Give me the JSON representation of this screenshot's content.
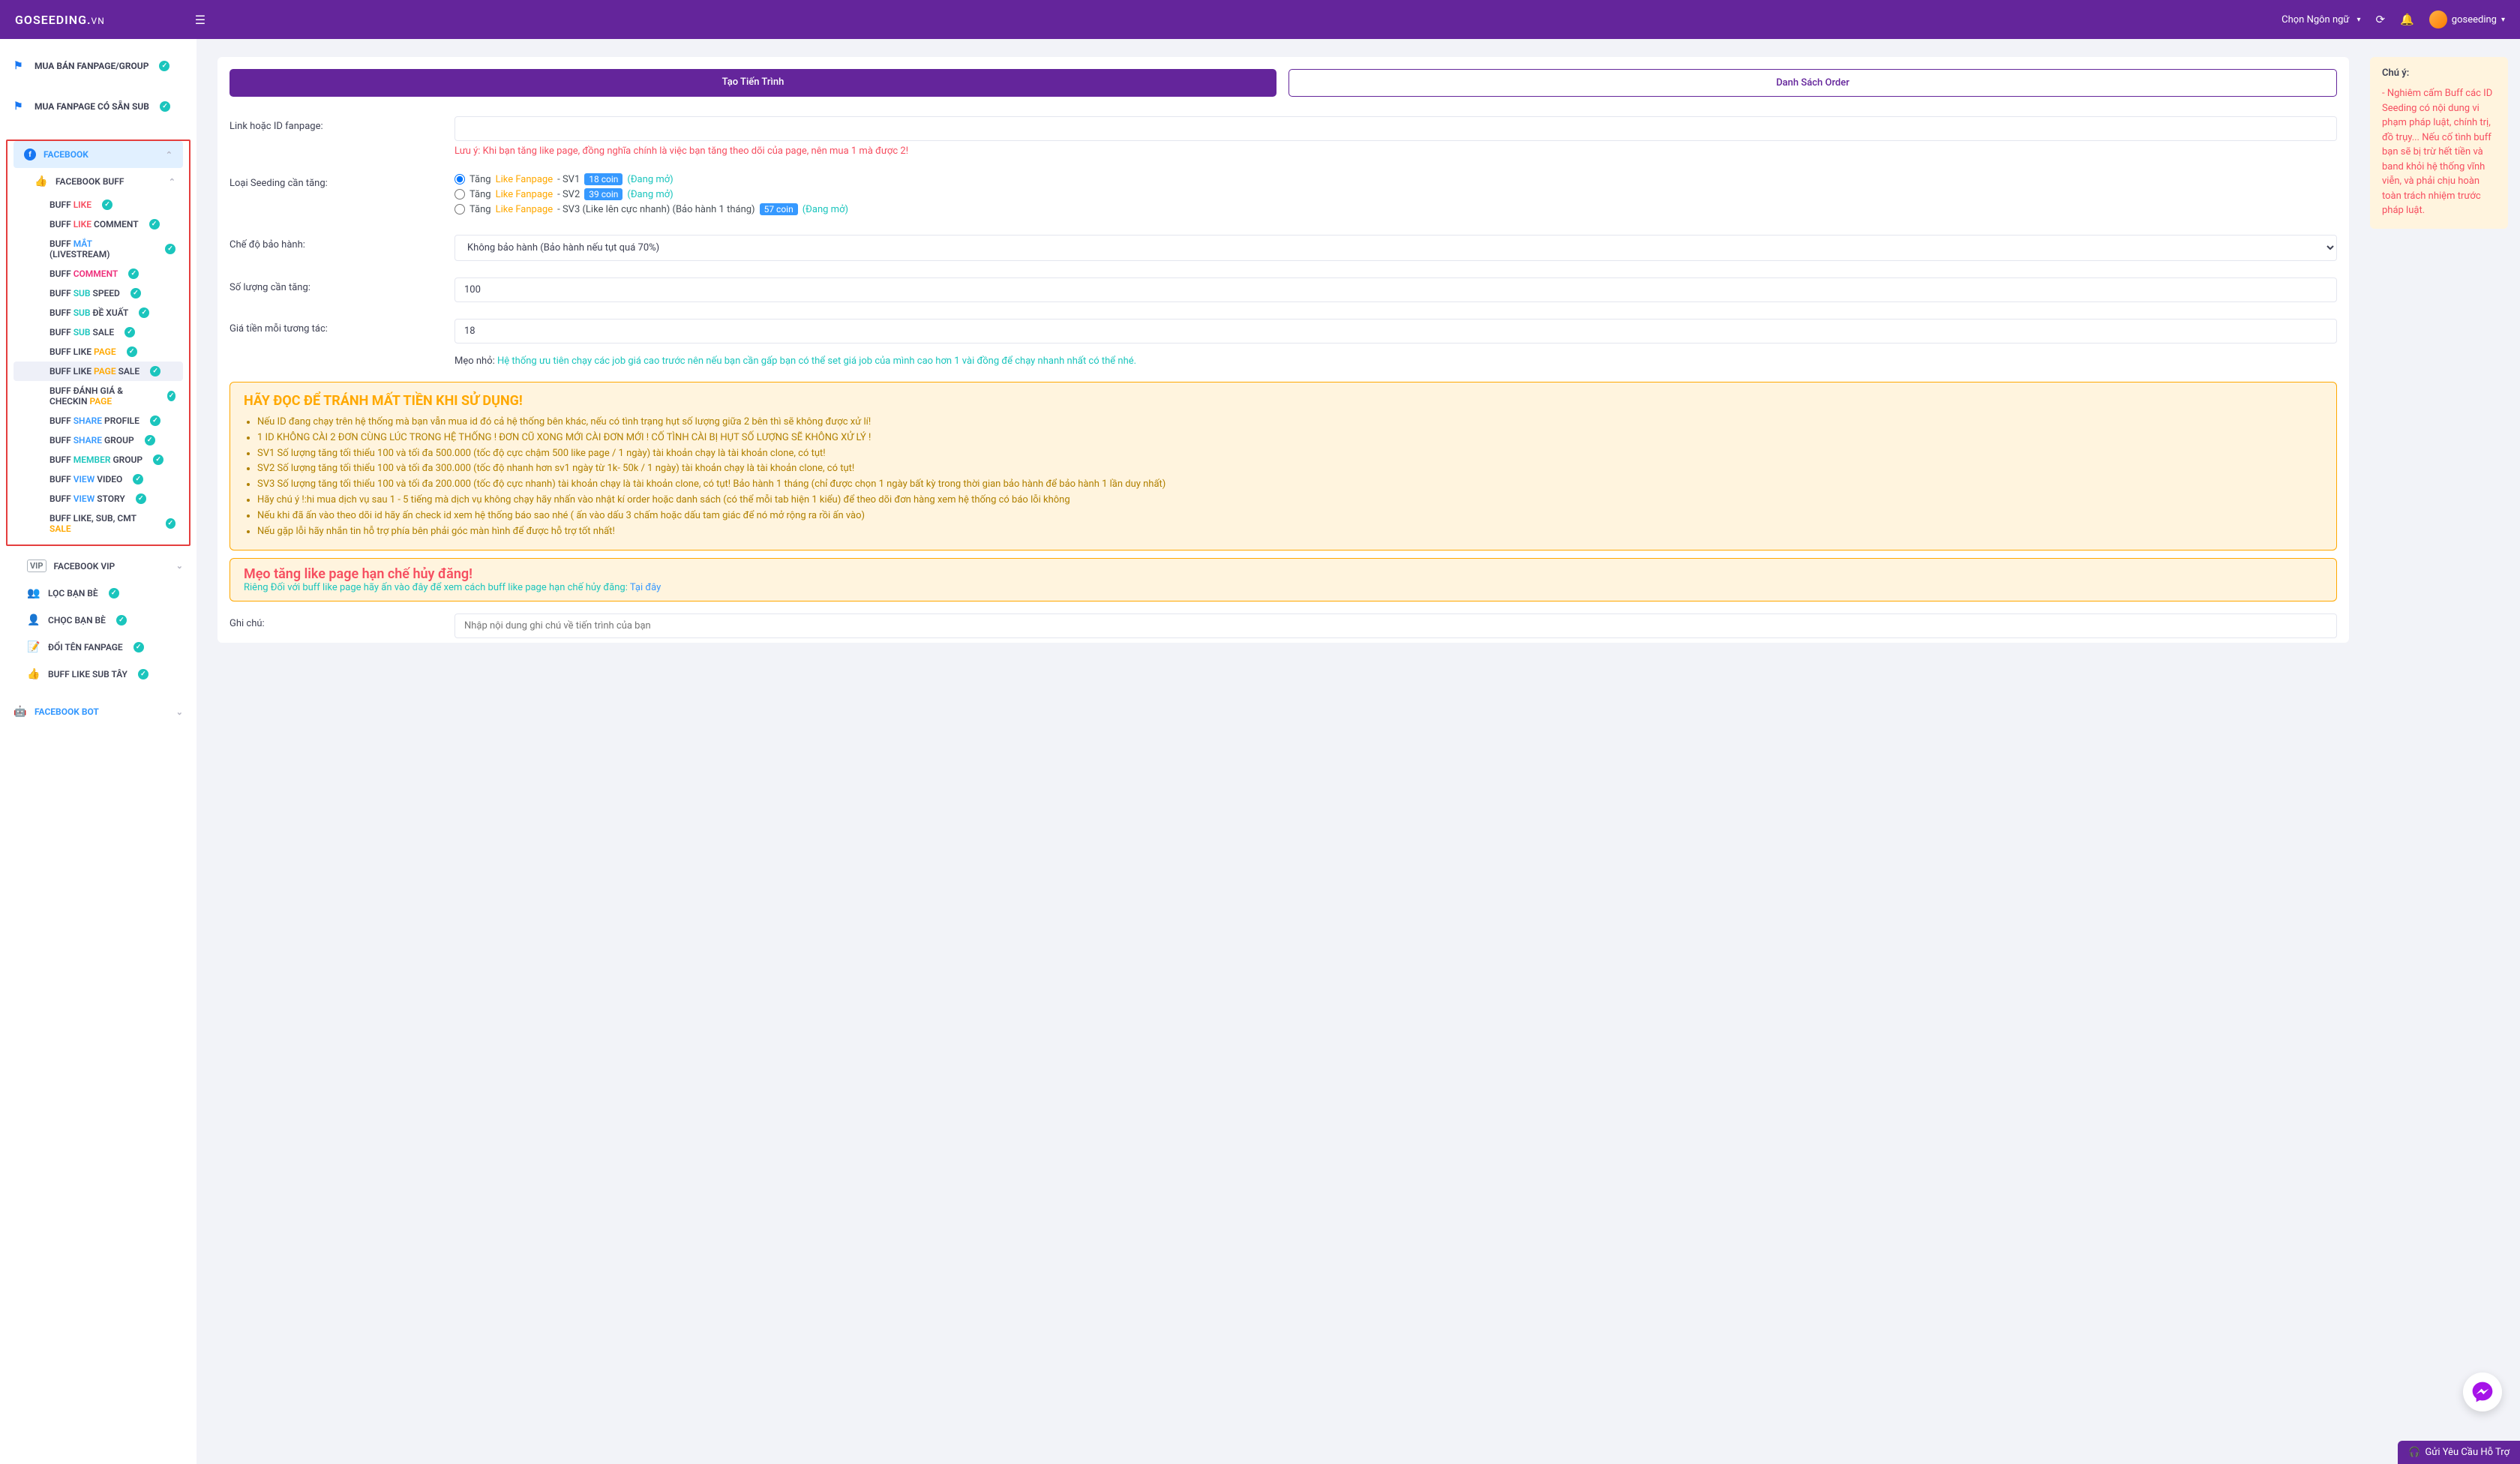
{
  "header": {
    "logo": "GOSEEDING.",
    "logo_suffix": "VN",
    "lang_label": "Chọn Ngôn ngữ",
    "username": "goseeding"
  },
  "sidebar": {
    "group1": "MUA BÁN FANPAGE/GROUP",
    "group2": "MUA FANPAGE CÓ SẴN SUB",
    "facebook": "FACEBOOK",
    "fbbuff": "FACEBOOK BUFF",
    "items": [
      {
        "pre": "BUFF ",
        "hi": "LIKE",
        "post": "",
        "cls": "c-red"
      },
      {
        "pre": "BUFF ",
        "hi": "LIKE",
        "post": " COMMENT",
        "cls": "c-red"
      },
      {
        "pre": "BUFF ",
        "hi": "MẮT",
        "post": " (LIVESTREAM)",
        "cls": "c-blue"
      },
      {
        "pre": "BUFF ",
        "hi": "COMMENT",
        "post": "",
        "cls": "c-pink"
      },
      {
        "pre": "BUFF ",
        "hi": "SUB",
        "post": " SPEED",
        "cls": "c-green"
      },
      {
        "pre": "BUFF ",
        "hi": "SUB",
        "post": " ĐỀ XUẤT",
        "cls": "c-green"
      },
      {
        "pre": "BUFF ",
        "hi": "SUB",
        "post": " SALE",
        "cls": "c-green"
      },
      {
        "pre": "BUFF LIKE ",
        "hi": "PAGE",
        "post": "",
        "cls": "c-orange"
      },
      {
        "pre": "BUFF LIKE ",
        "hi": "PAGE",
        "post": " SALE",
        "cls": "c-orange"
      },
      {
        "pre": "BUFF ĐÁNH GIÁ & CHECKIN ",
        "hi": "PAGE",
        "post": "",
        "cls": "c-orange"
      },
      {
        "pre": "BUFF ",
        "hi": "SHARE",
        "post": " PROFILE",
        "cls": "c-blue"
      },
      {
        "pre": "BUFF ",
        "hi": "SHARE",
        "post": " GROUP",
        "cls": "c-blue"
      },
      {
        "pre": "BUFF ",
        "hi": "MEMBER",
        "post": " GROUP",
        "cls": "c-green"
      },
      {
        "pre": "BUFF ",
        "hi": "VIEW",
        "post": " VIDEO",
        "cls": "c-blue"
      },
      {
        "pre": "BUFF ",
        "hi": "VIEW",
        "post": " STORY",
        "cls": "c-blue"
      },
      {
        "pre": "BUFF LIKE, SUB, CMT ",
        "hi": "SALE",
        "post": "",
        "cls": "c-orange"
      }
    ],
    "fbvip": "FACEBOOK VIP",
    "loc": "LỌC BẠN BÈ",
    "choc": "CHỌC BẠN BÈ",
    "doiten": "ĐỔI TÊN FANPAGE",
    "bufftay": "BUFF LIKE SUB TÂY",
    "fbbot": "FACEBOOK BOT"
  },
  "tabs": {
    "tab1": "Tạo Tiến Trình",
    "tab2": "Danh Sách Order"
  },
  "form": {
    "link_label": "Link hoặc ID fanpage:",
    "link_warn": "Lưu ý: Khi bạn tăng like page, đồng nghĩa chính là việc bạn tăng theo dõi của page, nên mua 1 mà được 2!",
    "type_label": "Loại Seeding cần tăng:",
    "opt_pre": "Tăng ",
    "opt_link": "Like Fanpage",
    "opt1_post": " - SV1 ",
    "opt1_coin": "18 coin",
    "opt2_post": " - SV2 ",
    "opt2_coin": "39 coin",
    "opt3_post": " - SV3 (Like lên cực nhanh) (Bảo hành 1 tháng) ",
    "opt3_coin": "57 coin",
    "status_open": "(Đang mở)",
    "warranty_label": "Chế độ bảo hành:",
    "warranty_value": "Không bảo hành (Bảo hành nếu tụt quá 70%)",
    "qty_label": "Số lượng cần tăng:",
    "qty_value": "100",
    "price_label": "Giá tiền mỗi tương tác:",
    "price_value": "18",
    "tip_label": "Mẹo nhỏ: ",
    "tip_text": "Hệ thống ưu tiên chạy các job giá cao trước nên nếu bạn cần gấp bạn có thể set giá job của mình cao hơn 1 vài đồng để chạy nhanh nhất có thể nhé.",
    "note_label": "Ghi chú:",
    "note_placeholder": "Nhập nội dung ghi chú về tiến trình của bạn"
  },
  "alert": {
    "title": "HÃY ĐỌC ĐỂ TRÁNH MẤT TIỀN KHI SỬ DỤNG!",
    "items": [
      "Nếu ID đang chạy trên hệ thống mà bạn vẫn mua id đó cả hệ thống bên khác, nếu có tình trạng hụt số lượng giữa 2 bên thì sẽ không được xử lí!",
      "1 ID KHÔNG CÀI 2 ĐƠN CÙNG LÚC TRONG HỆ THỐNG ! ĐƠN CŨ XONG MỚI CÀI ĐƠN MỚI ! CỐ TÌNH CÀI BỊ HỤT SỐ LƯỢNG SẼ KHÔNG XỬ LÝ !",
      "SV1 Số lượng tăng tối thiểu 100 và tối đa 500.000 (tốc độ cực chậm 500 like page / 1 ngày) tài khoản chạy là tài khoản clone, có tụt!",
      "SV2 Số lượng tăng tối thiểu 100 và tối đa 300.000 (tốc độ nhanh hơn sv1 ngày từ 1k- 50k / 1 ngày) tài khoản chạy là tài khoản clone, có tụt!",
      "SV3 Số lượng tăng tối thiểu 100 và tối đa 200.000 (tốc độ cực nhanh) tài khoản chạy là tài khoản clone, có tụt! Bảo hành 1 tháng (chỉ được chọn 1 ngày bất kỳ trong thời gian bảo hành để bảo hành 1 lần duy nhất)",
      "Hãy chú ý !:hi mua dịch vụ sau 1 - 5 tiếng mà dịch vụ không chạy hãy nhấn vào nhật kí order hoặc danh sách (có thể mỗi tab hiện 1 kiểu) để theo dõi đơn hàng xem hệ thống có báo lỗi không",
      "Nếu khi đã ấn vào theo dõi id hãy ấn check id xem hệ thống báo sao nhé ( ấn vào dấu 3 chấm hoặc dấu tam giác để nó mở rộng ra rồi ấn vào)",
      "Nếu gặp lỗi hãy nhắn tin hỗ trợ phía bên phải góc màn hình để được hỗ trợ tốt nhất!"
    ]
  },
  "alert2": {
    "title": "Mẹo tăng like page hạn chế hủy đăng!",
    "sub": "Riêng Đối với buff like page hãy ấn vào đây để xem cách buff like page hạn chế hủy đăng: ",
    "link": "Tại đây"
  },
  "rightnote": {
    "title": "Chú ý:",
    "body": "- Nghiêm cấm Buff các ID Seeding có nội dung vi phạm pháp luật, chính trị, đồ trụy... Nếu cố tình buff bạn sẽ bị trừ hết tiền và band khỏi hệ thống vĩnh viễn, và phải chịu hoàn toàn trách nhiệm trước pháp luật."
  },
  "support_btn": "Gửi Yêu Cầu Hỗ Trợ"
}
